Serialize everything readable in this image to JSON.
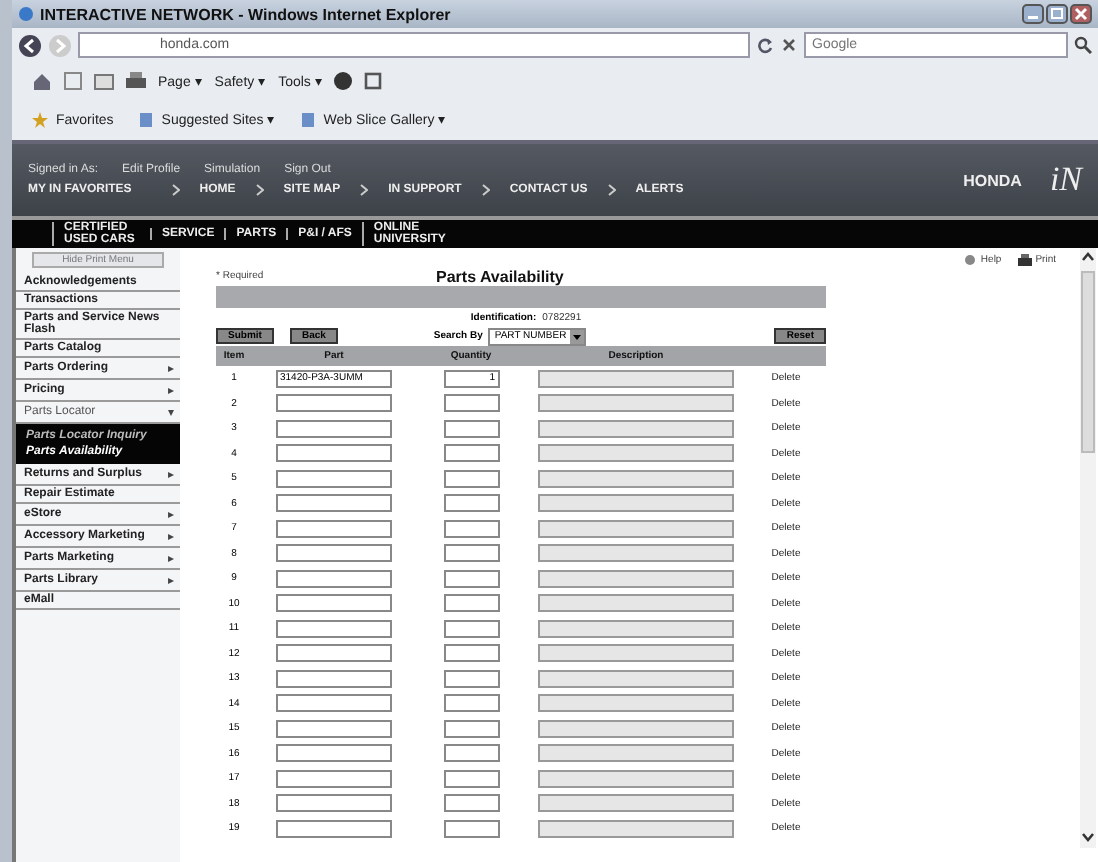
{
  "window": {
    "title": "INTERACTIVE NETWORK - Windows Internet Explorer"
  },
  "browser": {
    "address": "honda.com",
    "search_placeholder": "Google",
    "commands": [
      "Page ▾",
      "Safety ▾",
      "Tools ▾"
    ],
    "favorites": [
      "Favorites",
      "Suggested Sites ▾",
      "Web Slice Gallery ▾"
    ]
  },
  "site_header": {
    "user_links": [
      "Signed in As:",
      "Edit Profile",
      "Simulation",
      "Sign Out"
    ],
    "nav": [
      "MY IN FAVORITES",
      "HOME",
      "SITE MAP",
      "IN SUPPORT",
      "CONTACT US",
      "ALERTS"
    ],
    "brand": "HONDA",
    "logo": "iN"
  },
  "tabs": [
    {
      "label": "CERTIFIED USED CARS",
      "selected": false
    },
    {
      "label": "SERVICE",
      "selected": false
    },
    {
      "label": "PARTS",
      "selected": false
    },
    {
      "label": "P&I / AFS",
      "selected": false
    },
    {
      "label": "ONLINE UNIVERSITY",
      "selected": false
    }
  ],
  "sidebar": {
    "hide_button": "Hide Print Menu",
    "items": [
      {
        "label": "Acknowledgements"
      },
      {
        "label": "Transactions"
      },
      {
        "label": "Parts and Service News Flash"
      },
      {
        "label": "Parts Catalog"
      },
      {
        "label": "Parts Ordering",
        "arrow": "▸"
      },
      {
        "label": "Pricing",
        "arrow": "▸"
      },
      {
        "label": "Parts Locator",
        "arrow": "▾",
        "expanded": true,
        "children": [
          {
            "label": "Parts Locator Inquiry",
            "selected": false
          },
          {
            "label": "Parts Availability",
            "selected": true
          }
        ]
      },
      {
        "label": "Returns and Surplus",
        "arrow": "▸"
      },
      {
        "label": "Repair Estimate"
      },
      {
        "label": "eStore",
        "arrow": "▸"
      },
      {
        "label": "Accessory Marketing",
        "arrow": "▸"
      },
      {
        "label": "Parts Marketing",
        "arrow": "▸"
      },
      {
        "label": "Parts Library",
        "arrow": "▸"
      },
      {
        "label": "eMall"
      }
    ]
  },
  "content": {
    "help": "Help",
    "print": "Print",
    "required_note": "* Required",
    "title": "Parts Availability",
    "identification_label": "Identification:",
    "identification_value": "0782291",
    "buttons": [
      "Submit",
      "Back"
    ],
    "search_by_label": "Search By",
    "search_by_value": "PART NUMBER",
    "reset": "Reset",
    "columns": [
      "Item",
      "Part",
      "Quantity",
      "Description"
    ],
    "rows": [
      {
        "item": "1",
        "part": "31420-P3A-3UMM",
        "quantity": "1",
        "action": "Delete"
      },
      {
        "item": "2",
        "action": "Delete"
      },
      {
        "item": "3",
        "action": "Delete"
      },
      {
        "item": "4",
        "action": "Delete"
      },
      {
        "item": "5",
        "action": "Delete"
      },
      {
        "item": "6",
        "action": "Delete"
      },
      {
        "item": "7",
        "action": "Delete"
      },
      {
        "item": "8",
        "action": "Delete"
      },
      {
        "item": "9",
        "action": "Delete"
      },
      {
        "item": "10",
        "action": "Delete"
      },
      {
        "item": "11",
        "action": "Delete"
      },
      {
        "item": "12",
        "action": "Delete"
      },
      {
        "item": "13",
        "action": "Delete"
      },
      {
        "item": "14",
        "action": "Delete"
      },
      {
        "item": "15",
        "action": "Delete"
      },
      {
        "item": "16",
        "action": "Delete"
      },
      {
        "item": "17",
        "action": "Delete"
      },
      {
        "item": "18",
        "action": "Delete"
      },
      {
        "item": "19",
        "action": "Delete"
      }
    ]
  }
}
